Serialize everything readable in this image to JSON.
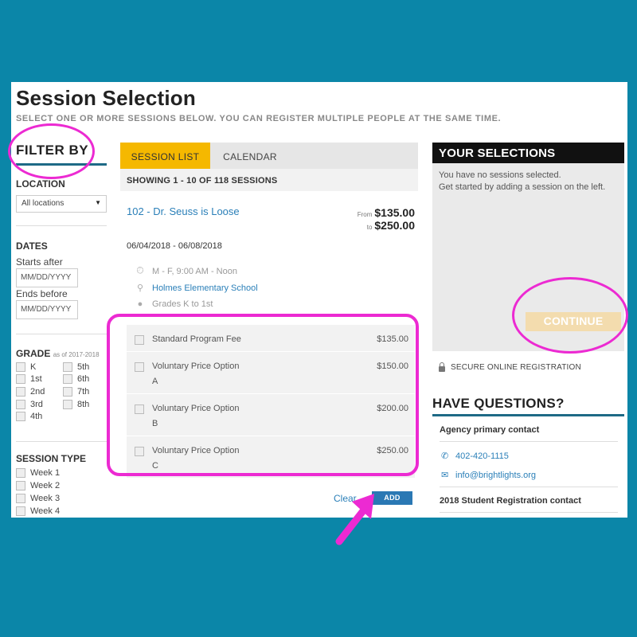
{
  "page": {
    "title": "Session Selection",
    "subtitle": "SELECT ONE OR MORE SESSIONS BELOW. YOU CAN REGISTER MULTIPLE PEOPLE AT THE SAME TIME."
  },
  "filters": {
    "title": "FILTER BY",
    "location_label": "LOCATION",
    "location_value": "All locations",
    "dates_label": "DATES",
    "starts_after_label": "Starts after",
    "starts_after_placeholder": "MM/DD/YYYY",
    "ends_before_label": "Ends before",
    "ends_before_placeholder": "MM/DD/YYYY",
    "grade_label": "GRADE",
    "grade_note": "as of 2017-2018",
    "grades": [
      "K",
      "1st",
      "2nd",
      "3rd",
      "4th",
      "5th",
      "6th",
      "7th",
      "8th"
    ],
    "session_type_label": "SESSION TYPE",
    "session_types": [
      "Week 1",
      "Week 2",
      "Week 3",
      "Week 4"
    ]
  },
  "main": {
    "tabs": [
      {
        "label": "SESSION LIST",
        "active": true
      },
      {
        "label": "CALENDAR",
        "active": false
      }
    ],
    "showing": "SHOWING 1 - 10 OF 118 SESSIONS",
    "session": {
      "title": "102 - Dr. Seuss is Loose",
      "from_prefix": "From",
      "from_price": "$135.00",
      "to_prefix": "to",
      "to_price": "$250.00",
      "dates": "06/04/2018 - 06/08/2018",
      "schedule": "M - F, 9:00 AM - Noon",
      "location": "Holmes Elementary School",
      "grades": "Grades K to 1st",
      "options": [
        {
          "label": "Standard Program Fee",
          "label2": "",
          "price": "$135.00"
        },
        {
          "label": "Voluntary Price Option",
          "label2": "A",
          "price": "$150.00"
        },
        {
          "label": "Voluntary Price Option",
          "label2": "B",
          "price": "$200.00"
        },
        {
          "label": "Voluntary Price Option",
          "label2": "C",
          "price": "$250.00"
        }
      ]
    },
    "clear_label": "Clear",
    "add_label": "ADD"
  },
  "selections": {
    "title": "YOUR SELECTIONS",
    "empty_line1": "You have no sessions selected.",
    "empty_line2": "Get started by adding a session on the left.",
    "continue_label": "CONTINUE",
    "secure_label": "SECURE ONLINE REGISTRATION"
  },
  "questions": {
    "title": "HAVE QUESTIONS?",
    "agency_title": "Agency primary contact",
    "phone": "402-420-1115",
    "email": "info@brightlights.org",
    "student_title": "2018 Student Registration contact"
  },
  "colors": {
    "background": "#0b86a8",
    "accent_tab": "#f5b800",
    "link": "#2a7fb8",
    "annotation": "#ec2ad2",
    "continue_button": "#f3dcae"
  }
}
